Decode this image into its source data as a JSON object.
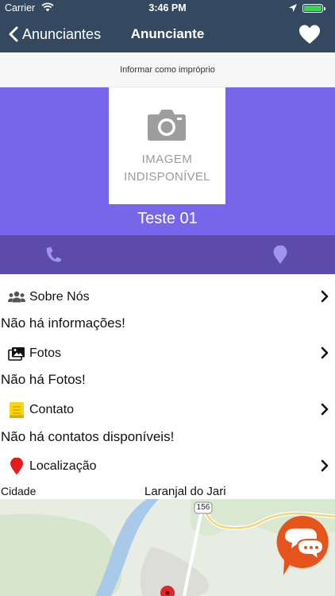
{
  "status_bar": {
    "carrier": "Carrier",
    "time": "3:46 PM"
  },
  "nav": {
    "back_label": "Anunciantes",
    "title": "Anunciante"
  },
  "report_link": "Informar como impróprio",
  "header": {
    "placeholder_line1": "IMAGEM",
    "placeholder_line2": "INDISPONÍVEL",
    "advertiser_name": "Teste 01"
  },
  "sections": {
    "about": {
      "label": "Sobre Nós",
      "message": "Não há informações!"
    },
    "photos": {
      "label": "Fotos",
      "message": "Não há Fotos!"
    },
    "contact": {
      "label": "Contato",
      "message": "Não há contatos disponíveis!"
    },
    "location": {
      "label": "Localização"
    }
  },
  "location": {
    "field_label": "Cidade",
    "city": "Laranjal do Jari"
  },
  "map": {
    "road_shield": "156"
  },
  "colors": {
    "navbar": "#34495f",
    "header_purple": "#7866ea",
    "actions_purple": "#5c4ba8",
    "chat_orange": "#e6541b",
    "map_pin": "#e0262b"
  }
}
